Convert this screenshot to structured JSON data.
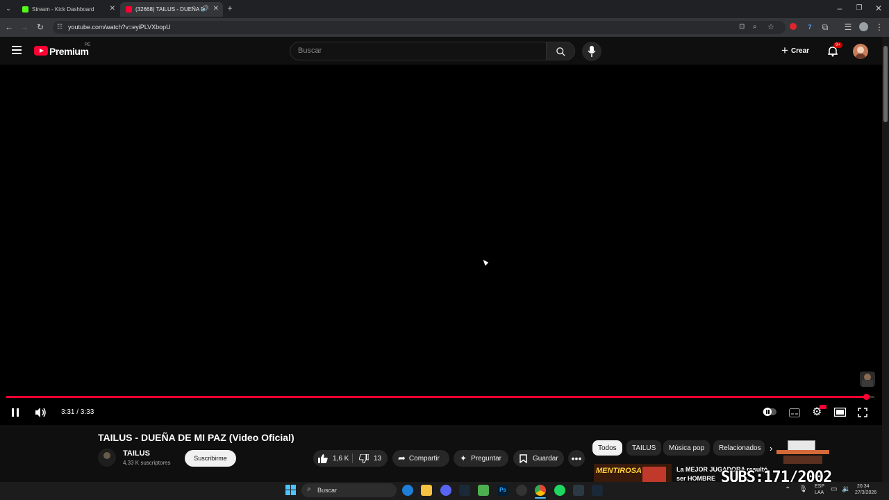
{
  "browser": {
    "tabs": [
      {
        "title": "Stream - Kick Dashboard",
        "active": false
      },
      {
        "title": "(32668) TAILUS - DUEÑA DE",
        "active": true
      }
    ],
    "url": "youtube.com/watch?v=eyiPLVXbopU"
  },
  "header": {
    "logo_text": "Premium",
    "logo_badge": "PE",
    "search_placeholder": "Buscar",
    "create_label": "Crear",
    "notifications_badge": "9+"
  },
  "player": {
    "time": "3:31 / 3:33",
    "progress": 0.99,
    "colors": {
      "progress": "#ff0033",
      "accent": "#ff0000"
    }
  },
  "video": {
    "title": "TAILUS - DUEÑA DE MI PAZ (Video Oficial)",
    "channel": "TAILUS",
    "subscribers": "4,33 K suscriptores",
    "subscribe_label": "Suscribirme",
    "likes": "1,6 K",
    "dislikes": "13",
    "share_label": "Compartir",
    "ask_label": "Preguntar",
    "save_label": "Guardar"
  },
  "chips": [
    "Todos",
    "TAILUS",
    "Música pop",
    "Relacionados"
  ],
  "recommendation": {
    "thumb_text": "MENTIROSA",
    "title_line1": "La MEJOR JUGADORA resultó",
    "title_line2": "ser HOMBRE"
  },
  "overlay": {
    "subs_text": "SUBS:171/2002"
  },
  "taskbar": {
    "search_placeholder": "Buscar",
    "lang_line1": "ESP",
    "lang_line2": "LAA",
    "time": "20:34",
    "date": "27/3/2026"
  }
}
